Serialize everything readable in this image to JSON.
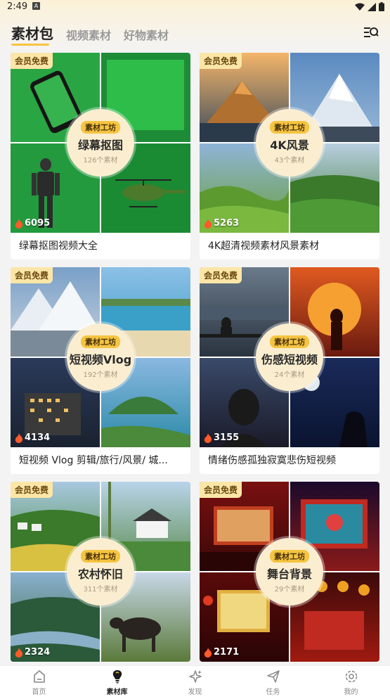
{
  "status_bar": {
    "time": "2:49",
    "notif_letter": "A"
  },
  "tabs": [
    {
      "label": "素材包"
    },
    {
      "label": "视频素材"
    },
    {
      "label": "好物素材"
    }
  ],
  "cards": [
    {
      "badge": "会员免费",
      "tag": "素材工坊",
      "name": "绿幕抠图",
      "count": "126个素材",
      "hot": "6095",
      "title": "绿幕抠图视频大全"
    },
    {
      "badge": "会员免费",
      "tag": "素材工坊",
      "name": "4K风景",
      "count": "43个素材",
      "hot": "5263",
      "title": "4K超清视频素材风景素材"
    },
    {
      "badge": "会员免费",
      "tag": "素材工坊",
      "name": "短视频Vlog",
      "count": "192个素材",
      "hot": "4134",
      "title": "短视频 Vlog 剪辑/旅行/风景/ 城..."
    },
    {
      "badge": "会员免费",
      "tag": "素材工坊",
      "name": "伤感短视频",
      "count": "24个素材",
      "hot": "3155",
      "title": "情绪伤感孤独寂寞悲伤短视频"
    },
    {
      "badge": "会员免费",
      "tag": "素材工坊",
      "name": "农村怀旧",
      "count": "311个素材",
      "hot": "2324",
      "title": ""
    },
    {
      "badge": "会员免费",
      "tag": "素材工坊",
      "name": "舞台背景",
      "count": "29个素材",
      "hot": "2171",
      "title": ""
    }
  ],
  "nav": [
    {
      "label": "首页",
      "icon": "home-icon"
    },
    {
      "label": "素材库",
      "icon": "lightbulb-icon"
    },
    {
      "label": "发现",
      "icon": "sparkle-icon"
    },
    {
      "label": "任务",
      "icon": "send-icon"
    },
    {
      "label": "我的",
      "icon": "gear-icon"
    }
  ],
  "colors": {
    "accent": "#f5c441",
    "badge_bg": "#fbe6a7",
    "circle_bg": "#fbeed0"
  }
}
